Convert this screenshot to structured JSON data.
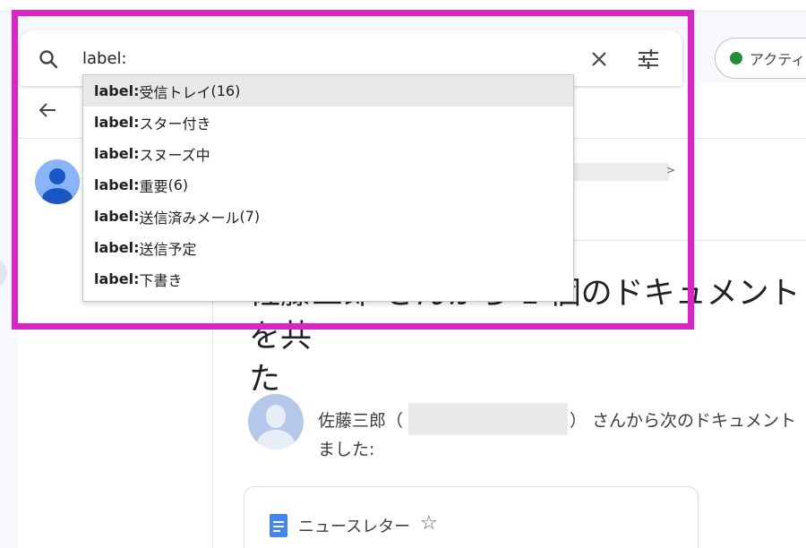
{
  "search": {
    "value": "label:",
    "suggestions": [
      {
        "prefix": "label:",
        "text": "受信トレイ",
        "count": " (16)"
      },
      {
        "prefix": "label:",
        "text": "スター付き",
        "count": ""
      },
      {
        "prefix": "label:",
        "text": "スヌーズ中",
        "count": ""
      },
      {
        "prefix": "label:",
        "text": "重要",
        "count": " (6)"
      },
      {
        "prefix": "label:",
        "text": "送信済みメール",
        "count": " (7)"
      },
      {
        "prefix": "label:",
        "text": "送信予定",
        "count": ""
      },
      {
        "prefix": "label:",
        "text": "下書き",
        "count": ""
      }
    ]
  },
  "status": {
    "label": "アクティブ",
    "color": "#1e8e3e"
  },
  "message": {
    "title_line1": "佐藤三郎 さんから 1 個のドキュメントを共",
    "title_line2": "た",
    "body_line1_a": "佐藤三郎（",
    "body_line1_b": "） さんから次のドキュメント",
    "body_line2": "ました:",
    "attachment": {
      "name": "ニュースレター"
    }
  },
  "icons": [
    "search-icon",
    "close-icon",
    "tune-icon",
    "back-arrow-icon",
    "star-icon",
    "docs-icon",
    "avatar-icon"
  ],
  "colors": {
    "highlight": "#e020c8",
    "accent": "#4285f4"
  }
}
